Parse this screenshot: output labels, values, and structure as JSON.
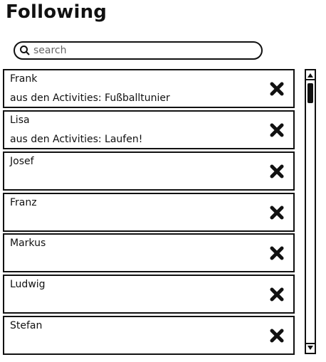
{
  "header": {
    "title": "Following"
  },
  "search": {
    "placeholder": "search"
  },
  "following": [
    {
      "name": "Frank",
      "subtitle": "aus den Activities: Fußballtunier"
    },
    {
      "name": "Lisa",
      "subtitle": "aus den Activities: Laufen!"
    },
    {
      "name": "Josef",
      "subtitle": ""
    },
    {
      "name": "Franz",
      "subtitle": ""
    },
    {
      "name": "Markus",
      "subtitle": ""
    },
    {
      "name": "Ludwig",
      "subtitle": ""
    },
    {
      "name": "Stefan",
      "subtitle": ""
    }
  ],
  "icons": {
    "search": "search-icon",
    "remove": "close-icon",
    "scroll_up": "arrow-up-icon",
    "scroll_down": "arrow-down-icon"
  },
  "colors": {
    "ink": "#111111",
    "background": "#ffffff"
  }
}
